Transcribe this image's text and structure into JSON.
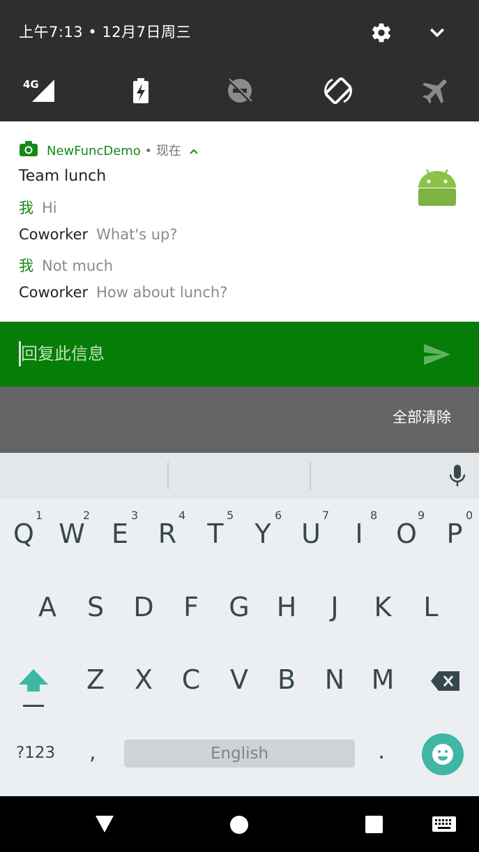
{
  "status_shade": {
    "datetime": "上午7:13 • 12月7日周三",
    "settings_icon": "gear-icon",
    "collapse_icon": "chevron-down-icon",
    "quick_tiles": [
      {
        "name": "mobile-data-icon",
        "label": "4G"
      },
      {
        "name": "battery-saver-icon"
      },
      {
        "name": "do-not-disturb-icon"
      },
      {
        "name": "auto-rotate-icon"
      },
      {
        "name": "airplane-mode-icon"
      }
    ]
  },
  "notification": {
    "app_name": "NewFuncDemo",
    "separator": " • ",
    "time": "现在",
    "title": "Team lunch",
    "messages": [
      {
        "sender": "我",
        "text": "Hi",
        "is_me": true
      },
      {
        "sender": "Coworker",
        "text": "What's up?",
        "is_me": false
      },
      {
        "sender": "我",
        "text": "Not much",
        "is_me": true
      },
      {
        "sender": "Coworker",
        "text": "How about lunch?",
        "is_me": false
      }
    ],
    "accent_color": "#138a18"
  },
  "reply": {
    "placeholder": "回复此信息",
    "value": "",
    "bar_color": "#067d07"
  },
  "clear_all": {
    "label": "全部清除"
  },
  "keyboard": {
    "row1": [
      "Q",
      "W",
      "E",
      "R",
      "T",
      "Y",
      "U",
      "I",
      "O",
      "P"
    ],
    "row1_hints": [
      "1",
      "2",
      "3",
      "4",
      "5",
      "6",
      "7",
      "8",
      "9",
      "0"
    ],
    "row2": [
      "A",
      "S",
      "D",
      "F",
      "G",
      "H",
      "J",
      "K",
      "L"
    ],
    "row3": [
      "Z",
      "X",
      "C",
      "V",
      "B",
      "N",
      "M"
    ],
    "symbols_label": "?123",
    "comma": ",",
    "space_label": "English",
    "period": ".",
    "accent_color": "#3fb6a6"
  },
  "navbar": {
    "back_icon": "back-icon",
    "home_icon": "home-icon",
    "recents_icon": "recents-icon",
    "keyboard_switch_icon": "keyboard-icon"
  }
}
